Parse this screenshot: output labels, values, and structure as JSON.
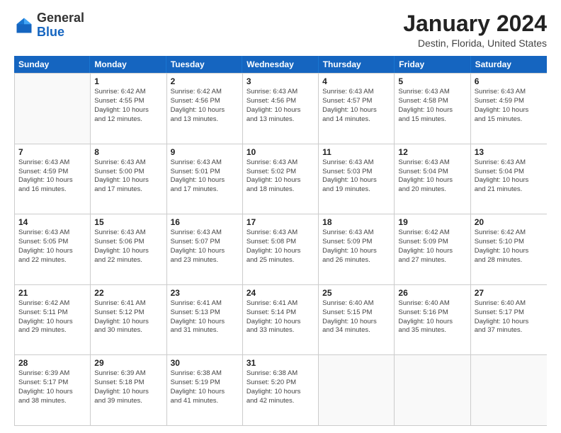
{
  "logo": {
    "general": "General",
    "blue": "Blue"
  },
  "title": "January 2024",
  "subtitle": "Destin, Florida, United States",
  "header_days": [
    "Sunday",
    "Monday",
    "Tuesday",
    "Wednesday",
    "Thursday",
    "Friday",
    "Saturday"
  ],
  "weeks": [
    [
      {
        "day": "",
        "lines": []
      },
      {
        "day": "1",
        "lines": [
          "Sunrise: 6:42 AM",
          "Sunset: 4:55 PM",
          "Daylight: 10 hours",
          "and 12 minutes."
        ]
      },
      {
        "day": "2",
        "lines": [
          "Sunrise: 6:42 AM",
          "Sunset: 4:56 PM",
          "Daylight: 10 hours",
          "and 13 minutes."
        ]
      },
      {
        "day": "3",
        "lines": [
          "Sunrise: 6:43 AM",
          "Sunset: 4:56 PM",
          "Daylight: 10 hours",
          "and 13 minutes."
        ]
      },
      {
        "day": "4",
        "lines": [
          "Sunrise: 6:43 AM",
          "Sunset: 4:57 PM",
          "Daylight: 10 hours",
          "and 14 minutes."
        ]
      },
      {
        "day": "5",
        "lines": [
          "Sunrise: 6:43 AM",
          "Sunset: 4:58 PM",
          "Daylight: 10 hours",
          "and 15 minutes."
        ]
      },
      {
        "day": "6",
        "lines": [
          "Sunrise: 6:43 AM",
          "Sunset: 4:59 PM",
          "Daylight: 10 hours",
          "and 15 minutes."
        ]
      }
    ],
    [
      {
        "day": "7",
        "lines": [
          "Sunrise: 6:43 AM",
          "Sunset: 4:59 PM",
          "Daylight: 10 hours",
          "and 16 minutes."
        ]
      },
      {
        "day": "8",
        "lines": [
          "Sunrise: 6:43 AM",
          "Sunset: 5:00 PM",
          "Daylight: 10 hours",
          "and 17 minutes."
        ]
      },
      {
        "day": "9",
        "lines": [
          "Sunrise: 6:43 AM",
          "Sunset: 5:01 PM",
          "Daylight: 10 hours",
          "and 17 minutes."
        ]
      },
      {
        "day": "10",
        "lines": [
          "Sunrise: 6:43 AM",
          "Sunset: 5:02 PM",
          "Daylight: 10 hours",
          "and 18 minutes."
        ]
      },
      {
        "day": "11",
        "lines": [
          "Sunrise: 6:43 AM",
          "Sunset: 5:03 PM",
          "Daylight: 10 hours",
          "and 19 minutes."
        ]
      },
      {
        "day": "12",
        "lines": [
          "Sunrise: 6:43 AM",
          "Sunset: 5:04 PM",
          "Daylight: 10 hours",
          "and 20 minutes."
        ]
      },
      {
        "day": "13",
        "lines": [
          "Sunrise: 6:43 AM",
          "Sunset: 5:04 PM",
          "Daylight: 10 hours",
          "and 21 minutes."
        ]
      }
    ],
    [
      {
        "day": "14",
        "lines": [
          "Sunrise: 6:43 AM",
          "Sunset: 5:05 PM",
          "Daylight: 10 hours",
          "and 22 minutes."
        ]
      },
      {
        "day": "15",
        "lines": [
          "Sunrise: 6:43 AM",
          "Sunset: 5:06 PM",
          "Daylight: 10 hours",
          "and 22 minutes."
        ]
      },
      {
        "day": "16",
        "lines": [
          "Sunrise: 6:43 AM",
          "Sunset: 5:07 PM",
          "Daylight: 10 hours",
          "and 23 minutes."
        ]
      },
      {
        "day": "17",
        "lines": [
          "Sunrise: 6:43 AM",
          "Sunset: 5:08 PM",
          "Daylight: 10 hours",
          "and 25 minutes."
        ]
      },
      {
        "day": "18",
        "lines": [
          "Sunrise: 6:43 AM",
          "Sunset: 5:09 PM",
          "Daylight: 10 hours",
          "and 26 minutes."
        ]
      },
      {
        "day": "19",
        "lines": [
          "Sunrise: 6:42 AM",
          "Sunset: 5:09 PM",
          "Daylight: 10 hours",
          "and 27 minutes."
        ]
      },
      {
        "day": "20",
        "lines": [
          "Sunrise: 6:42 AM",
          "Sunset: 5:10 PM",
          "Daylight: 10 hours",
          "and 28 minutes."
        ]
      }
    ],
    [
      {
        "day": "21",
        "lines": [
          "Sunrise: 6:42 AM",
          "Sunset: 5:11 PM",
          "Daylight: 10 hours",
          "and 29 minutes."
        ]
      },
      {
        "day": "22",
        "lines": [
          "Sunrise: 6:41 AM",
          "Sunset: 5:12 PM",
          "Daylight: 10 hours",
          "and 30 minutes."
        ]
      },
      {
        "day": "23",
        "lines": [
          "Sunrise: 6:41 AM",
          "Sunset: 5:13 PM",
          "Daylight: 10 hours",
          "and 31 minutes."
        ]
      },
      {
        "day": "24",
        "lines": [
          "Sunrise: 6:41 AM",
          "Sunset: 5:14 PM",
          "Daylight: 10 hours",
          "and 33 minutes."
        ]
      },
      {
        "day": "25",
        "lines": [
          "Sunrise: 6:40 AM",
          "Sunset: 5:15 PM",
          "Daylight: 10 hours",
          "and 34 minutes."
        ]
      },
      {
        "day": "26",
        "lines": [
          "Sunrise: 6:40 AM",
          "Sunset: 5:16 PM",
          "Daylight: 10 hours",
          "and 35 minutes."
        ]
      },
      {
        "day": "27",
        "lines": [
          "Sunrise: 6:40 AM",
          "Sunset: 5:17 PM",
          "Daylight: 10 hours",
          "and 37 minutes."
        ]
      }
    ],
    [
      {
        "day": "28",
        "lines": [
          "Sunrise: 6:39 AM",
          "Sunset: 5:17 PM",
          "Daylight: 10 hours",
          "and 38 minutes."
        ]
      },
      {
        "day": "29",
        "lines": [
          "Sunrise: 6:39 AM",
          "Sunset: 5:18 PM",
          "Daylight: 10 hours",
          "and 39 minutes."
        ]
      },
      {
        "day": "30",
        "lines": [
          "Sunrise: 6:38 AM",
          "Sunset: 5:19 PM",
          "Daylight: 10 hours",
          "and 41 minutes."
        ]
      },
      {
        "day": "31",
        "lines": [
          "Sunrise: 6:38 AM",
          "Sunset: 5:20 PM",
          "Daylight: 10 hours",
          "and 42 minutes."
        ]
      },
      {
        "day": "",
        "lines": []
      },
      {
        "day": "",
        "lines": []
      },
      {
        "day": "",
        "lines": []
      }
    ]
  ]
}
